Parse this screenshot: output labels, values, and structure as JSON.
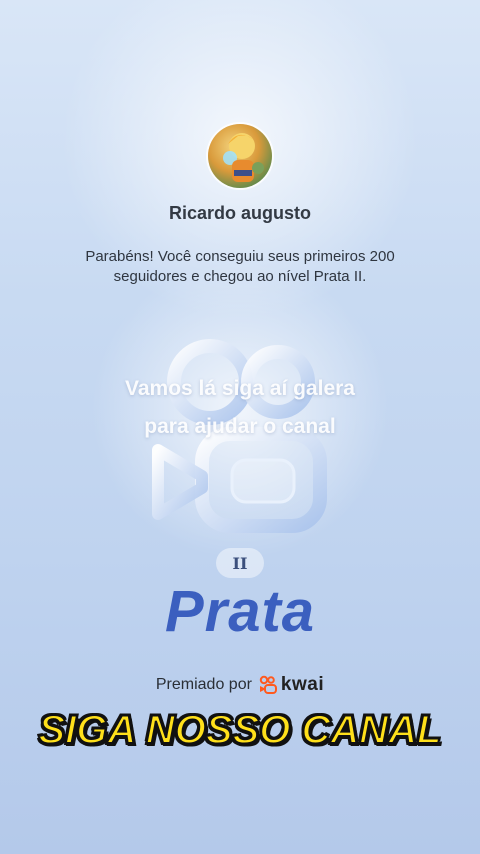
{
  "user": {
    "name": "Ricardo augusto"
  },
  "message": "Parabéns! Você conseguiu seus primeiros 200 seguidores e chegou ao nível Prata II.",
  "overlay_caption": "Vamos lá siga aí galera para ajudar o canal",
  "level": {
    "tier": "II",
    "name": "Prata"
  },
  "awarded_by": {
    "label": "Premiado por",
    "brand": "kwai",
    "brand_color": "#ff5a1f"
  },
  "banner": "SIGA NOSSO CANAL",
  "colors": {
    "level_blue": "#3b5fbf",
    "banner_yellow": "#ffe01a"
  }
}
